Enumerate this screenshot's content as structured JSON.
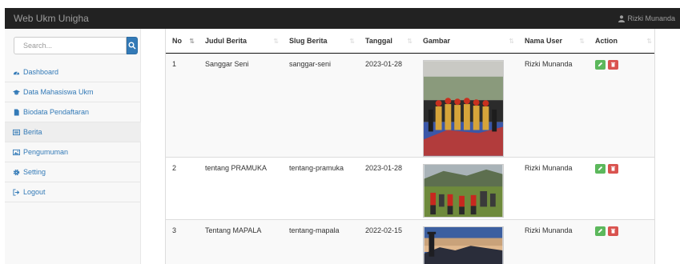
{
  "navbar": {
    "brand": "Web Ukm Unigha",
    "user_name": "Rizki Munanda"
  },
  "sidebar": {
    "search_placeholder": "Search...",
    "items": [
      {
        "label": "Dashboard",
        "icon": "dashboard-icon"
      },
      {
        "label": "Data Mahasiswa Ukm",
        "icon": "graduation-cap-icon"
      },
      {
        "label": "Biodata Pendaftaran",
        "icon": "file-icon"
      },
      {
        "label": "Berita",
        "icon": "newspaper-icon",
        "active": true
      },
      {
        "label": "Pengumuman",
        "icon": "image-icon"
      },
      {
        "label": "Setting",
        "icon": "gear-icon"
      },
      {
        "label": "Logout",
        "icon": "sign-out-icon"
      }
    ]
  },
  "table": {
    "columns": [
      "No",
      "Judul Berita",
      "Slug Berita",
      "Tanggal",
      "Gambar",
      "Nama User",
      "Action"
    ],
    "rows": [
      {
        "no": "1",
        "judul": "Sanggar Seni",
        "slug": "sanggar-seni",
        "tanggal": "2023-01-28",
        "gambar": "dance-group-photo",
        "user": "Rizki Munanda"
      },
      {
        "no": "2",
        "judul": "tentang PRAMUKA",
        "slug": "tentang-pramuka",
        "tanggal": "2023-01-28",
        "gambar": "scouts-photo",
        "user": "Rizki Munanda"
      },
      {
        "no": "3",
        "judul": "Tentang MAPALA",
        "slug": "tentang-mapala",
        "tanggal": "2022-02-15",
        "gambar": "mountain-photo",
        "user": "Rizki Munanda"
      }
    ]
  },
  "colors": {
    "navbar_bg": "#222222",
    "link": "#337ab7",
    "edit_button": "#5cb85c",
    "delete_button": "#d9534f"
  }
}
